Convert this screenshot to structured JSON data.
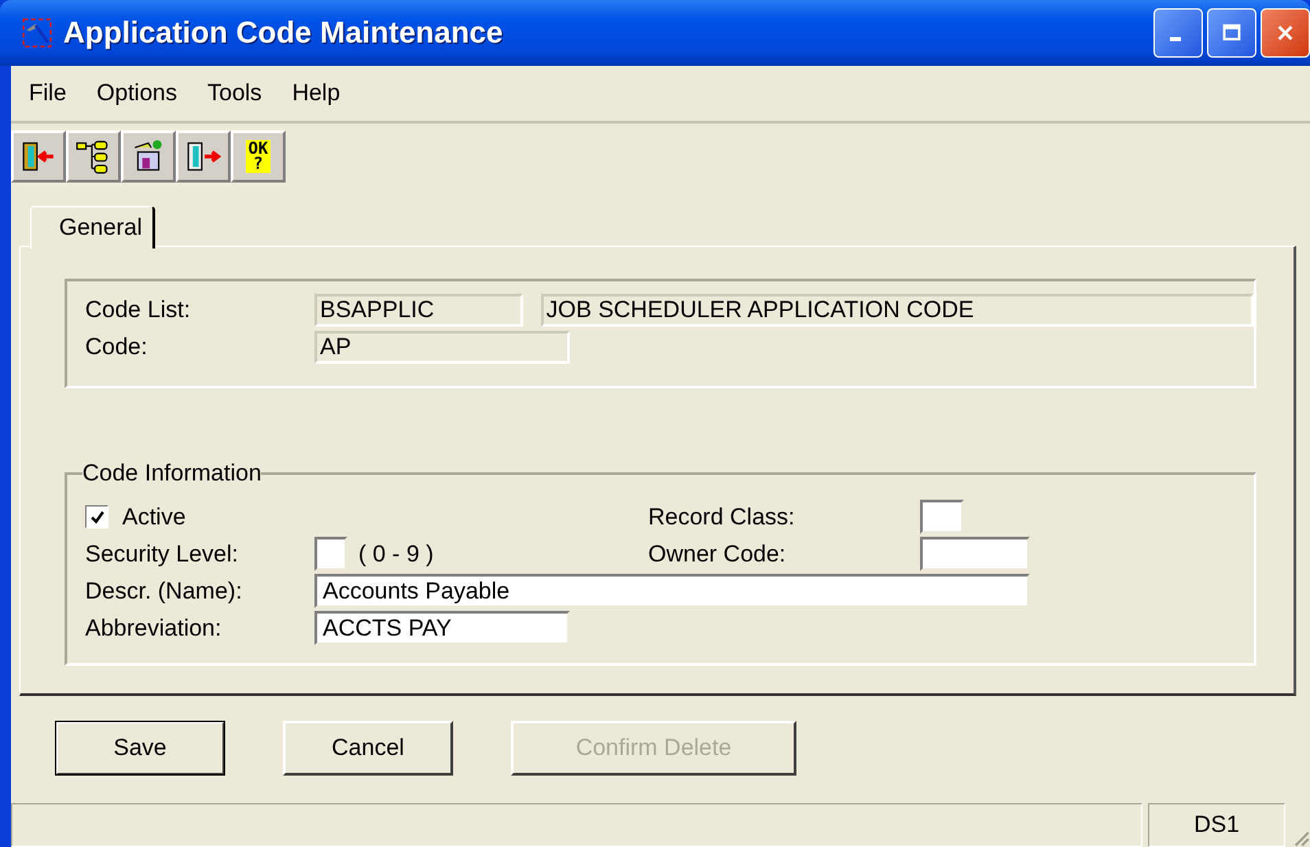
{
  "window": {
    "title": "Application Code Maintenance"
  },
  "menu": [
    "File",
    "Options",
    "Tools",
    "Help"
  ],
  "toolbar": [
    {
      "kind": "exit-left"
    },
    {
      "kind": "tree"
    },
    {
      "kind": "tools"
    },
    {
      "kind": "exit-right"
    },
    {
      "kind": "ok",
      "label": "OK",
      "sub": "?"
    }
  ],
  "tabs": [
    {
      "label": "General",
      "selected": true
    }
  ],
  "header": {
    "code_list_label": "Code List:",
    "code_list": "BSAPPLIC",
    "code_list_description": "JOB SCHEDULER APPLICATION CODE",
    "code_label": "Code:",
    "code": "AP"
  },
  "code_information": {
    "title": "Code Information",
    "active": {
      "label": "Active",
      "checked": true
    },
    "security_level": {
      "label": "Security Level:",
      "hint": "( 0 - 9 )"
    },
    "record_class": {
      "label": "Record Class:"
    },
    "owner_code": {
      "label": "Owner Code:"
    },
    "description": {
      "label": "Descr. (Name):",
      "value": "Accounts Payable"
    },
    "abbreviation": {
      "label": "Abbreviation:",
      "value": "ACCTS PAY"
    }
  },
  "buttons": [
    {
      "label": "Save",
      "default": true,
      "disabled": false
    },
    {
      "label": "Cancel",
      "default": false,
      "disabled": false
    },
    {
      "label": "Confirm Delete",
      "default": false,
      "disabled": true
    }
  ],
  "status_bar": {
    "panel": "DS1"
  }
}
